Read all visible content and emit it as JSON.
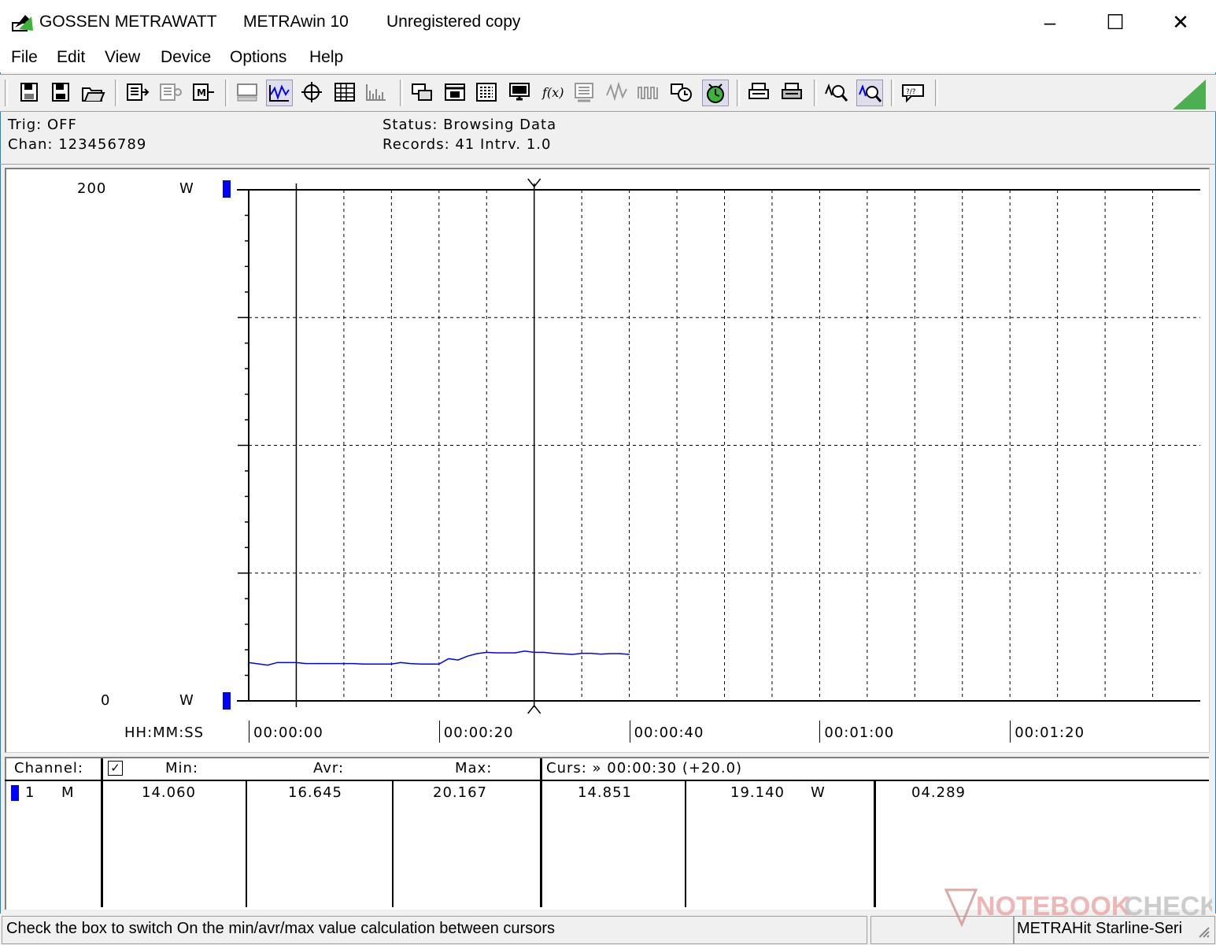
{
  "window": {
    "brand": "GOSSEN METRAWATT",
    "app": "METRAwin 10",
    "registration": "Unregistered copy",
    "minimize": "–",
    "maximize": "☐",
    "close": "✕"
  },
  "menu": [
    {
      "label": "File"
    },
    {
      "label": "Edit"
    },
    {
      "label": "View"
    },
    {
      "label": "Device"
    },
    {
      "label": "Options"
    },
    {
      "label": "Help"
    }
  ],
  "info": {
    "trig": "Trig: OFF",
    "chan": "Chan:  123456789",
    "status": "Status:   Browsing Data",
    "records": "Records: 41   Intrv. 1.0"
  },
  "plot": {
    "y_top": "200",
    "y_bottom": "0",
    "unit_top": "W",
    "unit_bottom": "W",
    "time_label": "HH:MM:SS",
    "ticks": [
      "00:00:00",
      "00:00:20",
      "00:00:40",
      "00:01:00",
      "00:01:20"
    ]
  },
  "chart_data": {
    "type": "line",
    "ylim": [
      0,
      200
    ],
    "xlim": [
      0,
      100
    ],
    "x": [
      0,
      2,
      3,
      4,
      5,
      6,
      7,
      8,
      9,
      10,
      11,
      12,
      13,
      14,
      15,
      16,
      17,
      18,
      19,
      20,
      21,
      22,
      23,
      24,
      25,
      26,
      27,
      28,
      29,
      30,
      31,
      32,
      33,
      34,
      35,
      36,
      37,
      38,
      39,
      40
    ],
    "series": [
      {
        "color": "#0000ff",
        "values": [
          15.0,
          14.0,
          15.0,
          15.0,
          15.0,
          14.6,
          14.6,
          14.6,
          14.6,
          14.6,
          14.6,
          14.4,
          14.4,
          14.4,
          14.4,
          15.0,
          14.6,
          14.4,
          14.4,
          14.4,
          16.5,
          16.0,
          17.5,
          18.5,
          19.0,
          18.8,
          18.8,
          18.8,
          19.5,
          19.0,
          19.0,
          18.6,
          18.4,
          18.2,
          18.6,
          18.6,
          18.3,
          18.5,
          18.5,
          18.2
        ]
      }
    ]
  },
  "table": {
    "headers": {
      "channel": "Channel:",
      "checkbox": "✓",
      "min": "Min:",
      "avr": "Avr:",
      "max": "Max:",
      "curs": "Curs: » 00:00:30 (+20.0)"
    },
    "row": {
      "ch_num": "1",
      "ch_mode": "M",
      "min": "14.060",
      "avr": "16.645",
      "max": "20.167",
      "c1": "14.851",
      "c2": "19.140",
      "unit": "W",
      "c3": "04.289"
    }
  },
  "status_bar": {
    "hint": "Check the box to switch On the min/avr/max value calculation between cursors",
    "device": "METRAHit Starline-Seri",
    "watermark": "NOTEBOOKCHECK"
  },
  "colors": {
    "trace": "#0000ff",
    "channel_marker": "#0000ff",
    "signal": "#4caf50"
  }
}
